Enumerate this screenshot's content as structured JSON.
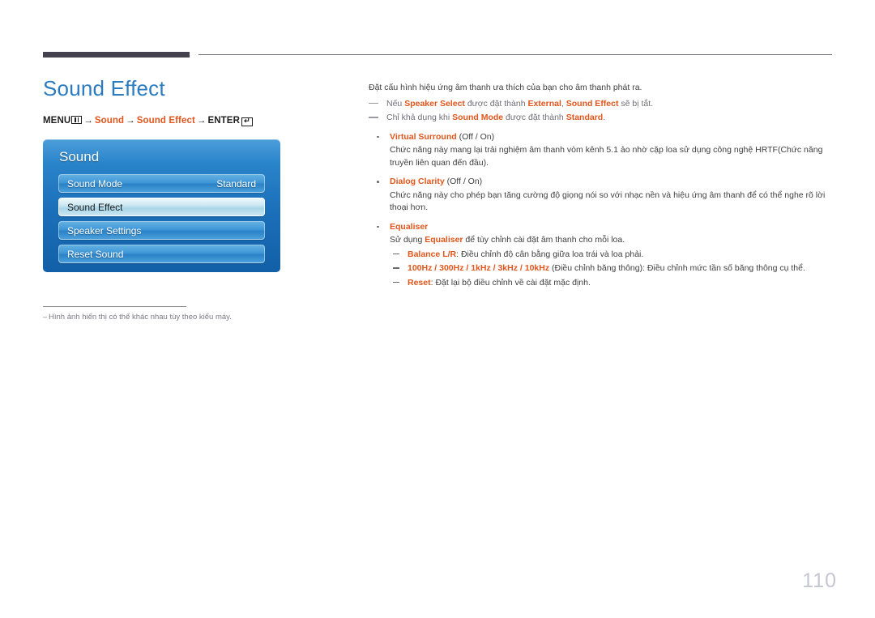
{
  "header": {
    "rule_thick_color": "#454250",
    "rule_thin_color": "#6f6c78"
  },
  "page": {
    "title": "Sound Effect",
    "number": "110",
    "accent_color": "#e2551c",
    "title_color": "#2a7bc0"
  },
  "menu_path": {
    "menu_label": "MENU",
    "arrow1": "→",
    "item1": "Sound",
    "arrow2": "→",
    "item2": "Sound Effect",
    "arrow3": "→",
    "enter_label": "ENTER",
    "enter_glyph": "↵"
  },
  "osd": {
    "title": "Sound",
    "rows": [
      {
        "label": "Sound Mode",
        "value": "Standard",
        "selected": false
      },
      {
        "label": "Sound Effect",
        "value": "",
        "selected": true
      },
      {
        "label": "Speaker Settings",
        "value": "",
        "selected": false
      },
      {
        "label": "Reset Sound",
        "value": "",
        "selected": false
      }
    ]
  },
  "footnote": {
    "dash": "–",
    "text": "Hình ảnh hiển thị có thể khác nhau tùy theo kiểu máy."
  },
  "content": {
    "intro": "Đặt cấu hình hiệu ứng âm thanh ưa thích của bạn cho âm thanh phát ra.",
    "notes": [
      {
        "p1": "Nếu ",
        "b1": "Speaker Select",
        "p2": " được đặt thành ",
        "b2": "External",
        "p3": ", ",
        "b3": "Sound Effect",
        "p4": " sẽ bị tắt."
      },
      {
        "p1": "Chỉ khả dụng khi ",
        "b1": "Sound Mode",
        "p2": " được đặt thành ",
        "b2": "Standard",
        "p3": ".",
        "b3": "",
        "p4": ""
      }
    ],
    "bullets": [
      {
        "title": "Virtual Surround",
        "title_suffix": " (Off / On)",
        "body": "Chức năng này mang lại trải nghiệm âm thanh vòm kênh 5.1 ảo nhờ cặp loa sử dụng công nghệ HRTF(Chức năng truyền liên quan đến đầu)."
      },
      {
        "title": "Dialog Clarity",
        "title_suffix": " (Off / On)",
        "body": "Chức năng này cho phép bạn tăng cường độ giọng nói so với nhạc nền và hiệu ứng âm thanh để có thể nghe rõ lời thoại hơn."
      }
    ],
    "equaliser": {
      "title": "Equaliser",
      "body_pre": "Sử dụng ",
      "body_accent": "Equaliser",
      "body_post": " để tùy chỉnh cài đặt âm thanh cho mỗi loa.",
      "subs": [
        {
          "accent": "Balance L/R",
          "rest": ": Điều chỉnh độ cân bằng giữa loa trái và loa phải."
        },
        {
          "accent": "100Hz / 300Hz / 1kHz / 3kHz / 10kHz",
          "rest": " (Điều chỉnh băng thông): Điều chỉnh mức tần số băng thông cụ thể."
        },
        {
          "accent": "Reset",
          "rest": ": Đặt lại bộ điều chỉnh về cài đặt mặc định."
        }
      ]
    }
  }
}
